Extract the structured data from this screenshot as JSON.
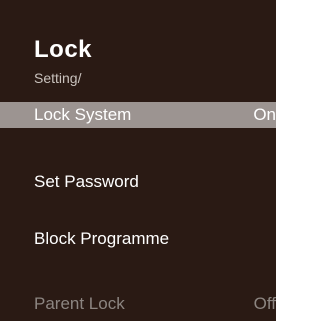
{
  "header": {
    "title": "Lock",
    "breadcrumb": "Setting/"
  },
  "menu": {
    "items": [
      {
        "label": "Lock System",
        "value": "On"
      },
      {
        "label": "Set Password",
        "value": ""
      },
      {
        "label": "Block Programme",
        "value": ""
      },
      {
        "label": "Parent Lock",
        "value": "Off"
      }
    ]
  }
}
